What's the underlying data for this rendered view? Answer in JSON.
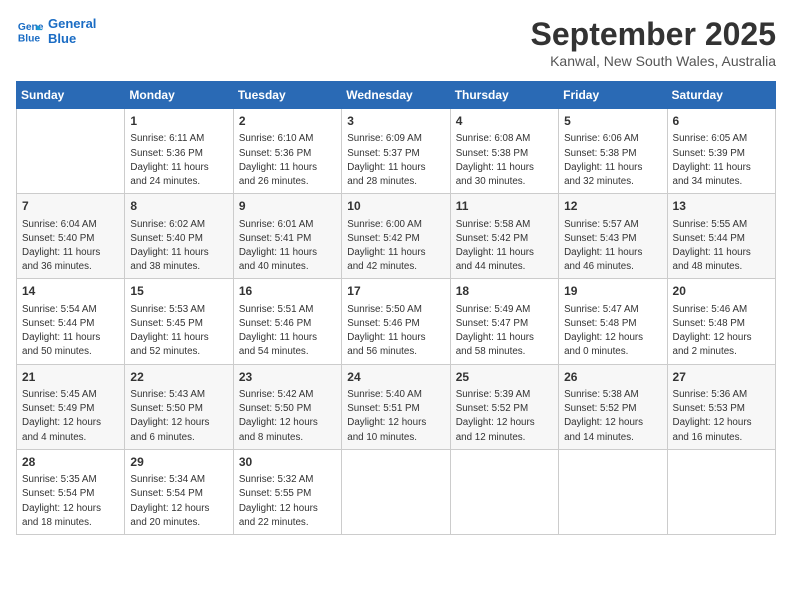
{
  "logo": {
    "line1": "General",
    "line2": "Blue"
  },
  "title": "September 2025",
  "location": "Kanwal, New South Wales, Australia",
  "days_of_week": [
    "Sunday",
    "Monday",
    "Tuesday",
    "Wednesday",
    "Thursday",
    "Friday",
    "Saturday"
  ],
  "weeks": [
    [
      {
        "day": "",
        "info": ""
      },
      {
        "day": "1",
        "info": "Sunrise: 6:11 AM\nSunset: 5:36 PM\nDaylight: 11 hours\nand 24 minutes."
      },
      {
        "day": "2",
        "info": "Sunrise: 6:10 AM\nSunset: 5:36 PM\nDaylight: 11 hours\nand 26 minutes."
      },
      {
        "day": "3",
        "info": "Sunrise: 6:09 AM\nSunset: 5:37 PM\nDaylight: 11 hours\nand 28 minutes."
      },
      {
        "day": "4",
        "info": "Sunrise: 6:08 AM\nSunset: 5:38 PM\nDaylight: 11 hours\nand 30 minutes."
      },
      {
        "day": "5",
        "info": "Sunrise: 6:06 AM\nSunset: 5:38 PM\nDaylight: 11 hours\nand 32 minutes."
      },
      {
        "day": "6",
        "info": "Sunrise: 6:05 AM\nSunset: 5:39 PM\nDaylight: 11 hours\nand 34 minutes."
      }
    ],
    [
      {
        "day": "7",
        "info": "Sunrise: 6:04 AM\nSunset: 5:40 PM\nDaylight: 11 hours\nand 36 minutes."
      },
      {
        "day": "8",
        "info": "Sunrise: 6:02 AM\nSunset: 5:40 PM\nDaylight: 11 hours\nand 38 minutes."
      },
      {
        "day": "9",
        "info": "Sunrise: 6:01 AM\nSunset: 5:41 PM\nDaylight: 11 hours\nand 40 minutes."
      },
      {
        "day": "10",
        "info": "Sunrise: 6:00 AM\nSunset: 5:42 PM\nDaylight: 11 hours\nand 42 minutes."
      },
      {
        "day": "11",
        "info": "Sunrise: 5:58 AM\nSunset: 5:42 PM\nDaylight: 11 hours\nand 44 minutes."
      },
      {
        "day": "12",
        "info": "Sunrise: 5:57 AM\nSunset: 5:43 PM\nDaylight: 11 hours\nand 46 minutes."
      },
      {
        "day": "13",
        "info": "Sunrise: 5:55 AM\nSunset: 5:44 PM\nDaylight: 11 hours\nand 48 minutes."
      }
    ],
    [
      {
        "day": "14",
        "info": "Sunrise: 5:54 AM\nSunset: 5:44 PM\nDaylight: 11 hours\nand 50 minutes."
      },
      {
        "day": "15",
        "info": "Sunrise: 5:53 AM\nSunset: 5:45 PM\nDaylight: 11 hours\nand 52 minutes."
      },
      {
        "day": "16",
        "info": "Sunrise: 5:51 AM\nSunset: 5:46 PM\nDaylight: 11 hours\nand 54 minutes."
      },
      {
        "day": "17",
        "info": "Sunrise: 5:50 AM\nSunset: 5:46 PM\nDaylight: 11 hours\nand 56 minutes."
      },
      {
        "day": "18",
        "info": "Sunrise: 5:49 AM\nSunset: 5:47 PM\nDaylight: 11 hours\nand 58 minutes."
      },
      {
        "day": "19",
        "info": "Sunrise: 5:47 AM\nSunset: 5:48 PM\nDaylight: 12 hours\nand 0 minutes."
      },
      {
        "day": "20",
        "info": "Sunrise: 5:46 AM\nSunset: 5:48 PM\nDaylight: 12 hours\nand 2 minutes."
      }
    ],
    [
      {
        "day": "21",
        "info": "Sunrise: 5:45 AM\nSunset: 5:49 PM\nDaylight: 12 hours\nand 4 minutes."
      },
      {
        "day": "22",
        "info": "Sunrise: 5:43 AM\nSunset: 5:50 PM\nDaylight: 12 hours\nand 6 minutes."
      },
      {
        "day": "23",
        "info": "Sunrise: 5:42 AM\nSunset: 5:50 PM\nDaylight: 12 hours\nand 8 minutes."
      },
      {
        "day": "24",
        "info": "Sunrise: 5:40 AM\nSunset: 5:51 PM\nDaylight: 12 hours\nand 10 minutes."
      },
      {
        "day": "25",
        "info": "Sunrise: 5:39 AM\nSunset: 5:52 PM\nDaylight: 12 hours\nand 12 minutes."
      },
      {
        "day": "26",
        "info": "Sunrise: 5:38 AM\nSunset: 5:52 PM\nDaylight: 12 hours\nand 14 minutes."
      },
      {
        "day": "27",
        "info": "Sunrise: 5:36 AM\nSunset: 5:53 PM\nDaylight: 12 hours\nand 16 minutes."
      }
    ],
    [
      {
        "day": "28",
        "info": "Sunrise: 5:35 AM\nSunset: 5:54 PM\nDaylight: 12 hours\nand 18 minutes."
      },
      {
        "day": "29",
        "info": "Sunrise: 5:34 AM\nSunset: 5:54 PM\nDaylight: 12 hours\nand 20 minutes."
      },
      {
        "day": "30",
        "info": "Sunrise: 5:32 AM\nSunset: 5:55 PM\nDaylight: 12 hours\nand 22 minutes."
      },
      {
        "day": "",
        "info": ""
      },
      {
        "day": "",
        "info": ""
      },
      {
        "day": "",
        "info": ""
      },
      {
        "day": "",
        "info": ""
      }
    ]
  ]
}
